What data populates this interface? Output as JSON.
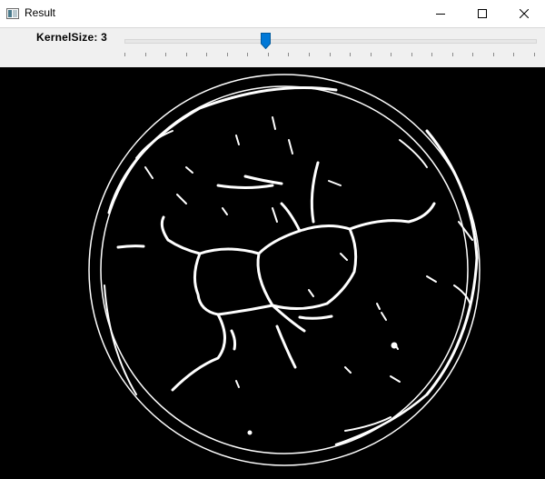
{
  "window": {
    "title": "Result",
    "icon": "opencv-window-icon"
  },
  "trackbar": {
    "label": "KernelSize: 3",
    "value": 3,
    "min": 0,
    "max": 20
  },
  "image": {
    "description_icon": "binary-edge-image",
    "background_color": "#000000",
    "foreground_color": "#ffffff"
  }
}
